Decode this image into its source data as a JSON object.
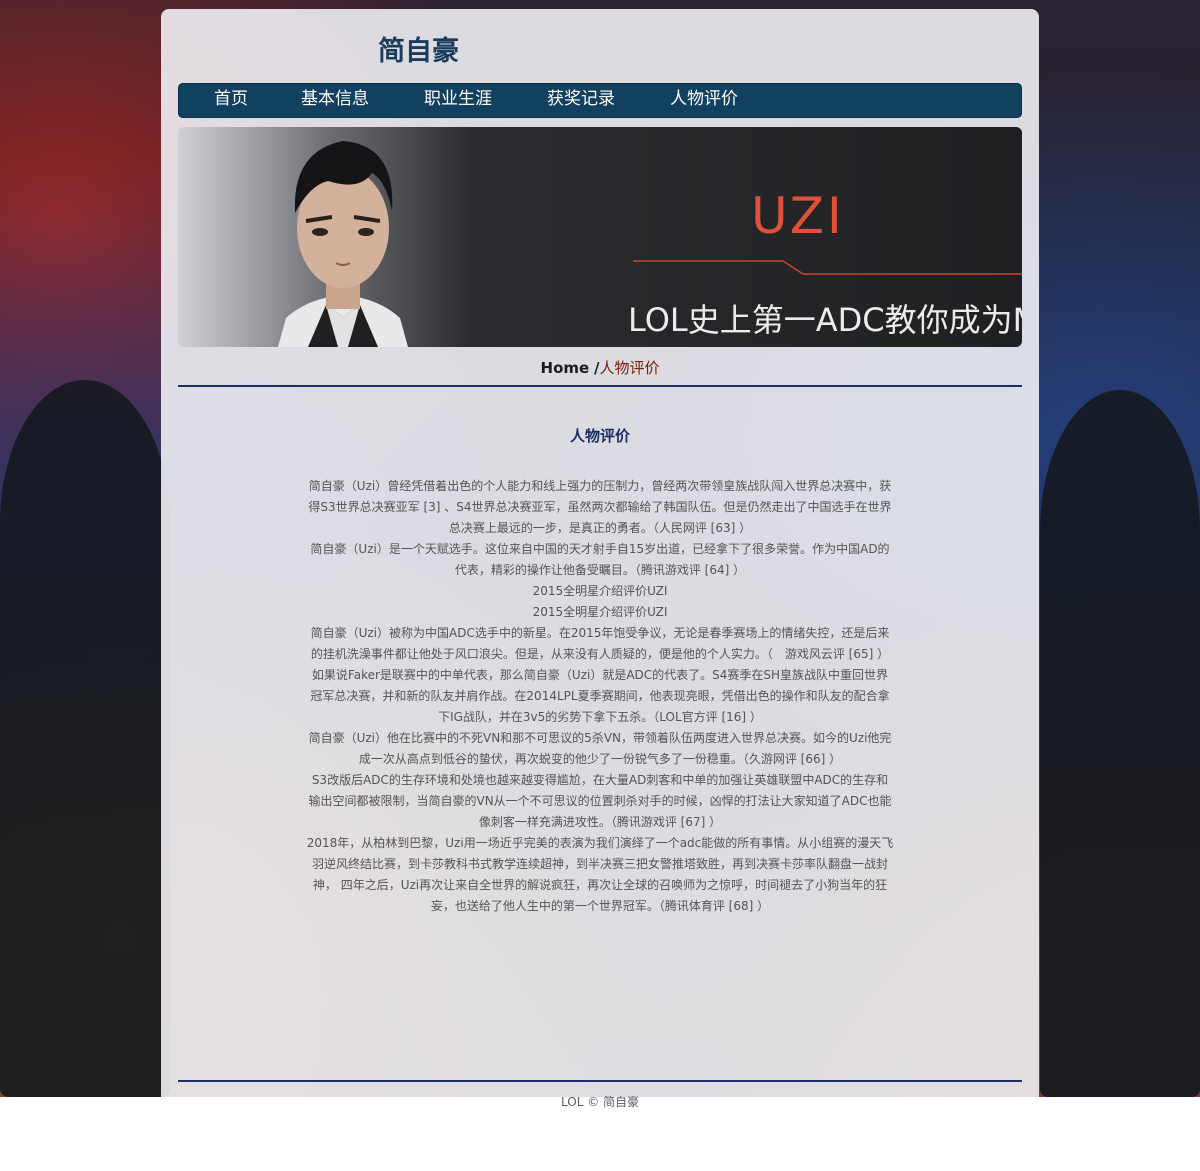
{
  "site": {
    "title": "简自豪"
  },
  "nav": {
    "items": [
      {
        "label": "首页"
      },
      {
        "label": "基本信息"
      },
      {
        "label": "职业生涯"
      },
      {
        "label": "获奖记录"
      },
      {
        "label": "人物评价"
      }
    ]
  },
  "banner": {
    "logo_text": "UZI",
    "slogan": "LOL史上第一ADC教你成为M"
  },
  "breadcrumb": {
    "home": "Home",
    "separator": "/",
    "current": "人物评价"
  },
  "section": {
    "title": "人物评价",
    "paragraphs": [
      "简自豪（Uzi）曾经凭借着出色的个人能力和线上强力的压制力，曾经两次带领皇族战队闯入世界总决赛中，获得S3世界总决赛亚军 [3] 、S4世界总决赛亚军，虽然两次都输给了韩国队伍。但是仍然走出了中国选手在世界总决赛上最远的一步，是真正的勇者。（人民网评 [63] ）",
      "简自豪（Uzi）是一个天赋选手。这位来自中国的天才射手自15岁出道，已经拿下了很多荣誉。作为中国AD的代表，精彩的操作让他备受瞩目。（腾讯游戏评 [64] ）",
      "2015全明星介绍评价UZI",
      "2015全明星介绍评价UZI",
      "简自豪（Uzi）被称为中国ADC选手中的新星。在2015年饱受争议，无论是春季赛场上的情绪失控，还是后来的挂机洗澡事件都让他处于风口浪尖。但是，从来没有人质疑的，便是他的个人实力。（　游戏风云评 [65] ）",
      "如果说Faker是联赛中的中单代表，那么简自豪（Uzi）就是ADC的代表了。S4赛季在SH皇族战队中重回世界冠军总决赛，并和新的队友并肩作战。在2014LPL夏季赛期间，他表现亮眼，凭借出色的操作和队友的配合拿下IG战队，并在3v5的劣势下拿下五杀。（LOL官方评 [16] ）",
      "简自豪（Uzi）他在比赛中的不死VN和那不可思议的5杀VN，带领着队伍两度进入世界总决赛。如今的Uzi他完成一次从高点到低谷的蛰伏，再次蜕变的他少了一份锐气多了一份稳重。（久游网评 [66] ）",
      "S3改版后ADC的生存环境和处境也越来越变得尴尬，在大量AD刺客和中单的加强让英雄联盟中ADC的生存和输出空间都被限制，当简自豪的VN从一个不可思议的位置刺杀对手的时候，凶悍的打法让大家知道了ADC也能像刺客一样充满进攻性。（腾讯游戏评 [67] ）",
      "2018年，从柏林到巴黎，Uzi用一场近乎完美的表演为我们演绎了一个adc能做的所有事情。从小组赛的漫天飞羽逆风终结比赛，到卡莎教科书式教学连续超神，到半决赛三把女警推塔致胜，再到决赛卡莎率队翻盘一战封神， 四年之后，Uzi再次让来自全世界的解说疯狂，再次让全球的召唤师为之惊呼，时间褪去了小狗当年的狂妄，也送给了他人生中的第一个世界冠军。（腾讯体育评 [68] ）"
    ]
  },
  "footer": {
    "text": "LOL © 简自豪"
  },
  "colors": {
    "nav_bg": "#12405f",
    "title": "#1b3b5c",
    "rule": "#1b2f63",
    "breadcrumb_current": "#7a1c0c",
    "logo": "#e0503a"
  }
}
